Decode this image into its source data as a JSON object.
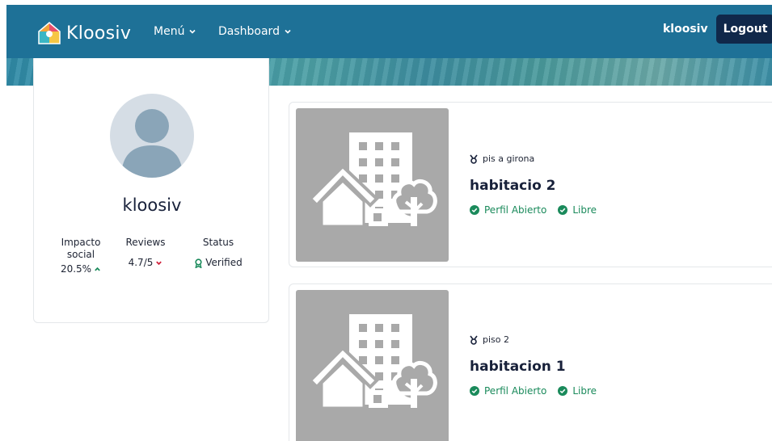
{
  "header": {
    "brand": "Kloosiv",
    "menu_label": "Menú",
    "dashboard_label": "Dashboard",
    "username": "kloosiv",
    "logout_label": "Logout"
  },
  "profile": {
    "name": "kloosiv",
    "impact_label": "Impacto social",
    "impact_value": "20.5%",
    "impact_trend": "up",
    "reviews_label": "Reviews",
    "reviews_value": "4.7/5",
    "reviews_trend": "down",
    "status_label": "Status",
    "status_value": "Verified"
  },
  "listings": [
    {
      "property": "pis a girona",
      "title": "habitacio 2",
      "tag_profile": "Perfil Abierto",
      "tag_status": "Libre"
    },
    {
      "property": "piso 2",
      "title": "habitacion 1",
      "tag_profile": "Perfil Abierto",
      "tag_status": "Libre"
    }
  ],
  "colors": {
    "navbar": "#1e7197",
    "logout_button": "#10284a",
    "tag_green": "#1a8a5b",
    "trend_up": "#1a8a5b",
    "trend_down": "#d0213b",
    "thumbnail_bg": "#a9a9a9"
  },
  "icons": {
    "logo": "kloosiv-logo-icon",
    "menu_chevron": "chevron-down-icon",
    "avatar": "user-avatar-icon",
    "trend_up": "caret-up-icon",
    "trend_down": "caret-down-icon",
    "verified": "award-icon",
    "property": "medal-icon",
    "tag": "check-circle-icon",
    "thumbnail": "building-placeholder-icon"
  }
}
